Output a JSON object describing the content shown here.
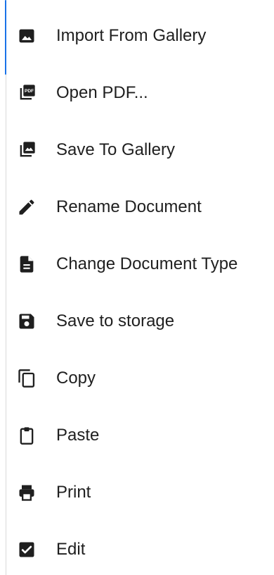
{
  "menu": {
    "items": [
      {
        "label": "Import From Gallery",
        "icon": "image-icon"
      },
      {
        "label": "Open PDF...",
        "icon": "pdf-icon"
      },
      {
        "label": "Save To Gallery",
        "icon": "photo-library-icon"
      },
      {
        "label": "Rename Document",
        "icon": "pencil-icon"
      },
      {
        "label": "Change Document Type",
        "icon": "document-icon"
      },
      {
        "label": "Save to storage",
        "icon": "floppy-disk-icon"
      },
      {
        "label": "Copy",
        "icon": "copy-icon"
      },
      {
        "label": "Paste",
        "icon": "clipboard-icon"
      },
      {
        "label": "Print",
        "icon": "printer-icon"
      },
      {
        "label": "Edit",
        "icon": "checkbox-icon"
      }
    ]
  },
  "colors": {
    "text": "#1f1f1f",
    "icon": "#1f1f1f",
    "accent": "#1a73e8",
    "background": "#ffffff"
  },
  "pdf_badge_text": "PDF"
}
